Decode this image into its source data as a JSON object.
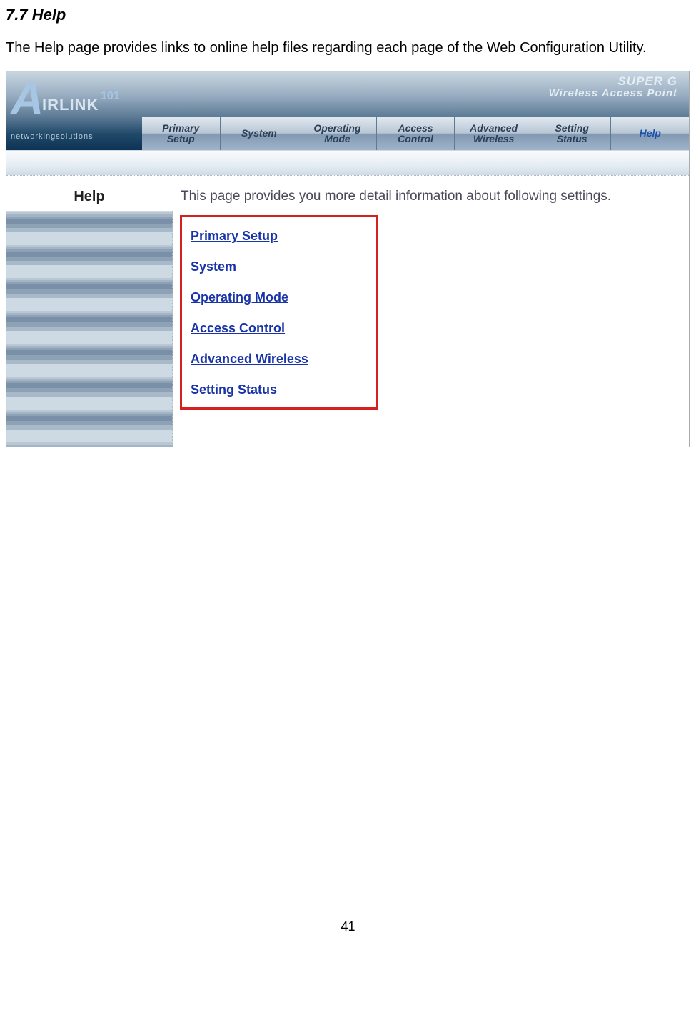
{
  "doc": {
    "heading": "7.7 Help",
    "body": "The Help page provides links to online help files regarding each page of the Web Configuration Utility.",
    "page_number": "41"
  },
  "logo": {
    "glyph": "A",
    "brand": "IRLINK",
    "suffix": "101",
    "tagline": "networkingsolutions"
  },
  "product": {
    "line1": "SUPER G",
    "line2": "Wireless Access Point"
  },
  "nav": [
    {
      "line1": "Primary",
      "line2": "Setup",
      "active": false
    },
    {
      "line1": "System",
      "line2": "",
      "active": false
    },
    {
      "line1": "Operating",
      "line2": "Mode",
      "active": false
    },
    {
      "line1": "Access",
      "line2": "Control",
      "active": false
    },
    {
      "line1": "Advanced",
      "line2": "Wireless",
      "active": false
    },
    {
      "line1": "Setting",
      "line2": "Status",
      "active": false
    },
    {
      "line1": "Help",
      "line2": "",
      "active": true
    }
  ],
  "content": {
    "label": "Help",
    "desc": "This page provides you more detail information about following settings."
  },
  "help_links": [
    "Primary Setup",
    "System",
    "Operating Mode",
    "Access Control",
    "Advanced Wireless",
    "Setting Status"
  ]
}
